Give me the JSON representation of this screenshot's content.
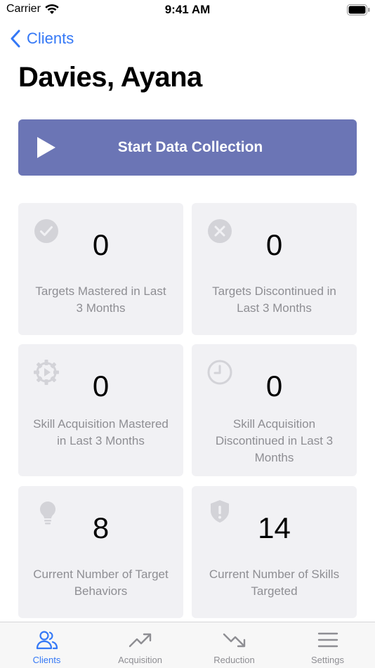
{
  "status_bar": {
    "carrier": "Carrier",
    "time": "9:41 AM"
  },
  "nav": {
    "back_label": "Clients"
  },
  "page": {
    "title": "Davies, Ayana"
  },
  "start_button": {
    "label": "Start Data Collection",
    "color": "#6b75b5"
  },
  "cards": [
    {
      "icon": "checkmark-circle-icon",
      "value": "0",
      "label": "Targets Mastered in Last 3 Months"
    },
    {
      "icon": "x-circle-icon",
      "value": "0",
      "label": "Targets Discontinued in Last 3 Months"
    },
    {
      "icon": "gear-play-icon",
      "value": "0",
      "label": "Skill Acquisition Mastered in Last 3 Months"
    },
    {
      "icon": "clock-icon",
      "value": "0",
      "label": "Skill Acquisition Discontinued in Last 3 Months"
    },
    {
      "icon": "lightbulb-icon",
      "value": "8",
      "label": "Current Number of Target Behaviors"
    },
    {
      "icon": "shield-exclamation-icon",
      "value": "14",
      "label": "Current Number of Skills Targeted"
    }
  ],
  "tabs": [
    {
      "label": "Clients",
      "icon": "people-icon",
      "active": true
    },
    {
      "label": "Acquisition",
      "icon": "trend-up-icon",
      "active": false
    },
    {
      "label": "Reduction",
      "icon": "trend-down-icon",
      "active": false
    },
    {
      "label": "Settings",
      "icon": "menu-lines-icon",
      "active": false
    }
  ],
  "colors": {
    "accent": "#3478f6",
    "card_background": "#f1f1f4",
    "secondary_text": "#8e8e93"
  }
}
